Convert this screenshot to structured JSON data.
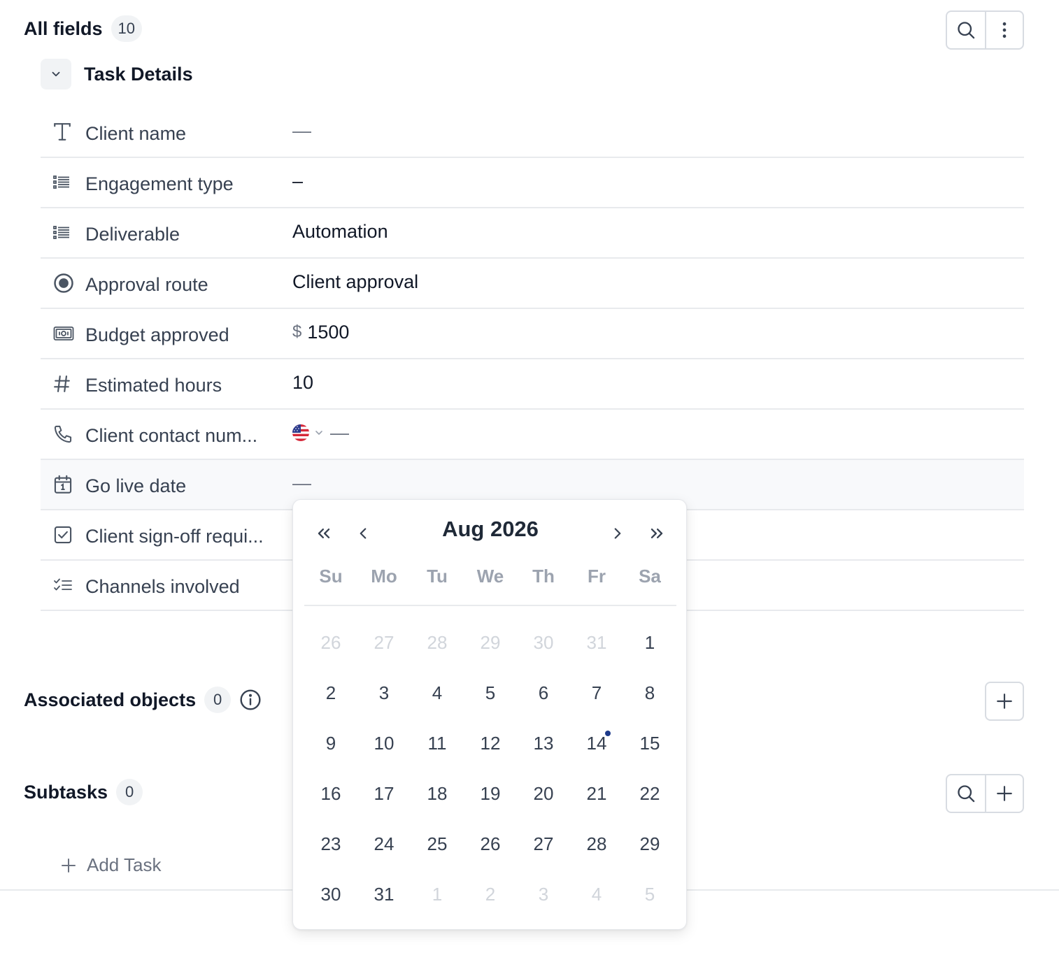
{
  "all_fields": {
    "title": "All fields",
    "count": "10"
  },
  "group": {
    "title": "Task Details"
  },
  "fields": [
    {
      "label": "Client name",
      "value": "—",
      "icon": "text-icon",
      "empty": true
    },
    {
      "label": "Engagement type",
      "value": "–",
      "icon": "list-icon",
      "empty": true
    },
    {
      "label": "Deliverable",
      "value": "Automation",
      "icon": "list-icon",
      "empty": false
    },
    {
      "label": "Approval route",
      "value": "Client approval",
      "icon": "radio-icon",
      "empty": false
    },
    {
      "label": "Budget approved",
      "value": "1500",
      "currency": "$",
      "icon": "money-icon",
      "empty": false
    },
    {
      "label": "Estimated hours",
      "value": "10",
      "icon": "hash-icon",
      "empty": false
    },
    {
      "label": "Client contact num...",
      "value": "—",
      "icon": "phone-icon",
      "empty": true
    },
    {
      "label": "Go live date",
      "value": "—",
      "icon": "calendar-icon",
      "empty": true
    },
    {
      "label": "Client sign-off requi...",
      "value": "",
      "icon": "checkbox-icon",
      "empty": true
    },
    {
      "label": "Channels involved",
      "value": "",
      "icon": "checklist-icon",
      "empty": true
    }
  ],
  "associated": {
    "title": "Associated objects",
    "count": "0"
  },
  "subtasks": {
    "title": "Subtasks",
    "count": "0",
    "add_label": "Add Task"
  },
  "calendar": {
    "month_label": "Aug 2026",
    "weekdays": [
      "Su",
      "Mo",
      "Tu",
      "We",
      "Th",
      "Fr",
      "Sa"
    ],
    "days": [
      {
        "n": "26",
        "muted": true
      },
      {
        "n": "27",
        "muted": true
      },
      {
        "n": "28",
        "muted": true
      },
      {
        "n": "29",
        "muted": true
      },
      {
        "n": "30",
        "muted": true
      },
      {
        "n": "31",
        "muted": true
      },
      {
        "n": "1"
      },
      {
        "n": "2"
      },
      {
        "n": "3"
      },
      {
        "n": "4"
      },
      {
        "n": "5"
      },
      {
        "n": "6"
      },
      {
        "n": "7"
      },
      {
        "n": "8"
      },
      {
        "n": "9"
      },
      {
        "n": "10"
      },
      {
        "n": "11"
      },
      {
        "n": "12"
      },
      {
        "n": "13"
      },
      {
        "n": "14",
        "today": true
      },
      {
        "n": "15"
      },
      {
        "n": "16"
      },
      {
        "n": "17"
      },
      {
        "n": "18"
      },
      {
        "n": "19"
      },
      {
        "n": "20"
      },
      {
        "n": "21"
      },
      {
        "n": "22"
      },
      {
        "n": "23"
      },
      {
        "n": "24"
      },
      {
        "n": "25"
      },
      {
        "n": "26"
      },
      {
        "n": "27"
      },
      {
        "n": "28"
      },
      {
        "n": "29"
      },
      {
        "n": "30"
      },
      {
        "n": "31"
      },
      {
        "n": "1",
        "muted": true
      },
      {
        "n": "2",
        "muted": true
      },
      {
        "n": "3",
        "muted": true
      },
      {
        "n": "4",
        "muted": true
      },
      {
        "n": "5",
        "muted": true
      }
    ]
  },
  "colors": {
    "today_dot": "#1e3a8a",
    "border": "#d8dce2",
    "muted_text": "#9ca3af"
  }
}
